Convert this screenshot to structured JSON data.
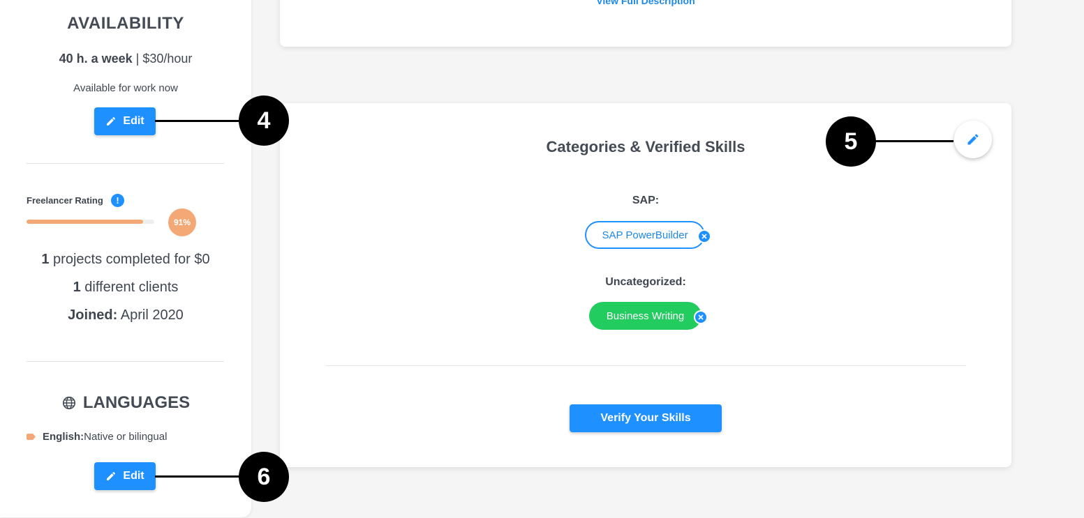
{
  "top_card": {
    "link": "View Full Description"
  },
  "availability": {
    "title": "AVAILABILITY",
    "hours": "40 h. a week",
    "separator": " | ",
    "rate": "$30/hour",
    "status": "Available for work now",
    "edit_label": "Edit"
  },
  "rating": {
    "label": "Freelancer Rating",
    "info_icon": "!",
    "percent_value": 91,
    "percent_label": "91%"
  },
  "stats": {
    "projects_count": "1",
    "projects_text": " projects completed for $0",
    "clients_count": "1",
    "clients_text": " different clients",
    "joined_label": "Joined:",
    "joined_value": " April 2020"
  },
  "languages": {
    "title": "LANGUAGES",
    "icon": "globe-icon",
    "items": [
      {
        "name": "English:",
        "level": " Native or bilingual"
      }
    ],
    "edit_label": "Edit"
  },
  "skills": {
    "title": "Categories & Verified Skills",
    "categories": [
      {
        "label": "SAP:",
        "skills": [
          "SAP PowerBuilder"
        ]
      },
      {
        "label": "Uncategorized:",
        "skills": [
          "Business Writing"
        ]
      }
    ],
    "verify_label": "Verify Your Skills"
  },
  "callouts": [
    "4",
    "5",
    "6"
  ],
  "colors": {
    "primary": "#1e90ff",
    "accent_orange": "#f4a875",
    "chip_green": "#22cc5e",
    "text": "#3f4650"
  }
}
